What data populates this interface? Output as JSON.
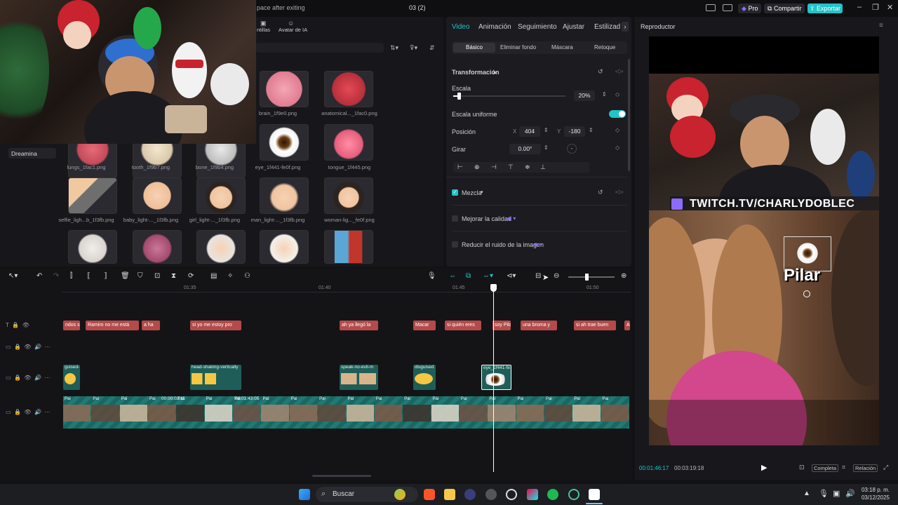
{
  "window": {
    "title": "03 (2)",
    "workspace_text": "pace after exiting",
    "pro_label": "Pro",
    "share_label": "Compartir",
    "export_label": "Exportar"
  },
  "colors": {
    "accent": "#1fc5c9",
    "clip_text": "#b44a4a",
    "clip_sticker": "#1f5e58",
    "video_track": "#1e7a74",
    "brand_pro": "#8c6cff"
  },
  "media": {
    "top_tabs": [
      "ntillas",
      "Avatar de IA"
    ],
    "sidebar_item": "Dreamina",
    "items": [
      "brain_1f9e0.png",
      "anatomical..._1fac0.png",
      "lungs_1fac1.png",
      "tooth_1f9b7.png",
      "bone_1f9b4.png",
      "eye_1f441-fe0f.png",
      "tongue_1f445.png",
      "selfie_ligh...b_1f3fb.png",
      "baby_light-..._1f3fb.png",
      "girl_light-..._1f3fb.png",
      "man_light-..._1f3fb.png",
      "woman-lig..._fe0f.png"
    ]
  },
  "props": {
    "tabs": [
      "Video",
      "Animación",
      "Seguimiento",
      "Ajustar",
      "Estilizad"
    ],
    "subtabs": [
      "Básico",
      "Eliminar fondo",
      "Máscara",
      "Retoque"
    ],
    "transform_title": "Transformación",
    "scale_label": "Escala",
    "scale_value": "20%",
    "scale_fraction": 0.05,
    "uniform_label": "Escala uniforme",
    "uniform_on": true,
    "position_label": "Posición",
    "pos_x_label": "X",
    "pos_x": "404",
    "pos_y_label": "Y",
    "pos_y": "-180",
    "rotate_label": "Girar",
    "rotate_value": "0.00°",
    "rotate_dash": "-",
    "mix_label": "Mezcla",
    "improve_label": "Mejorar la calidad",
    "denoise_label": "Reducir el ruido de la imagen"
  },
  "player": {
    "title": "Reproductor",
    "banner": "TWITCH.TV/CHARLYDOBLEC",
    "caption": "Pilar",
    "time_current": "00:01:46:17",
    "time_total": "00:03:19:18",
    "complete_label": "Completa",
    "ratio_label": "Relación"
  },
  "timeline": {
    "ruler": [
      "01:35",
      "01:40",
      "01:45",
      "01:50"
    ],
    "text_clips": [
      "ndos sal",
      "Ramiro no me está",
      "a ha",
      "si yo me estoy pro",
      "ah ya llegó la",
      "Macar",
      "si quién eres",
      "soy Pila",
      "una broma y",
      "si ah trae buen",
      "A"
    ],
    "sticker_clips": [
      "guised-",
      "head-shaking-vertically",
      "speak-no-evil-m",
      "disguised",
      "eye_1f441-fe"
    ],
    "video_labels": [
      "Pai",
      "Pai",
      "Pai",
      "Pai",
      "Pai",
      "Pai",
      "Pai",
      "Pai",
      "Pai",
      "Pai",
      "Pai",
      "Pai",
      "Pai",
      "Pai",
      "Pai",
      "Pai",
      "Pai",
      "Pai",
      "Pai",
      "Pai"
    ],
    "video_durations": [
      "00:00:03:11",
      "00:01:43:05"
    ]
  },
  "taskbar": {
    "search_label": "Buscar",
    "time": "03:18 p. m.",
    "date": "03/12/2025"
  }
}
